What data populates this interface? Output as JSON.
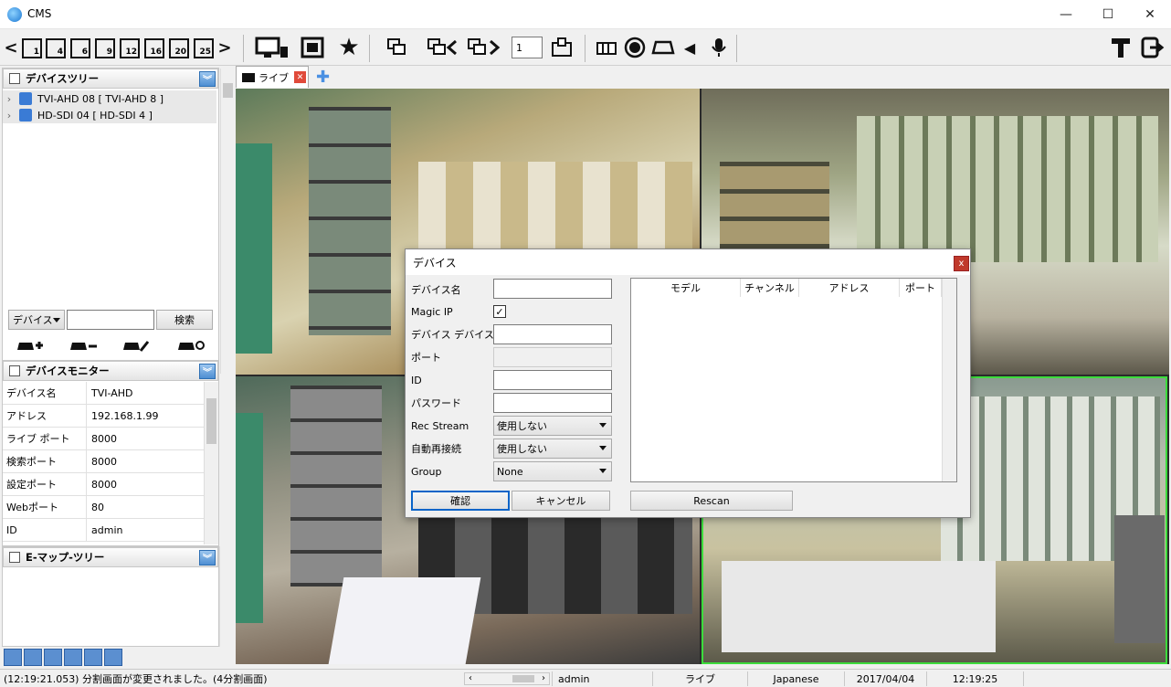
{
  "window": {
    "title": "CMS",
    "minimize": "—",
    "maximize": "☐",
    "close": "✕"
  },
  "toolbar": {
    "grid_options": [
      "1",
      "4",
      "6",
      "9",
      "12",
      "16",
      "20",
      "25"
    ],
    "page_value": "1",
    "nav_prev": "<",
    "nav_next": ">"
  },
  "device_tree": {
    "title": "デバイスツリー",
    "items": [
      {
        "label": "TVI-AHD 08 [ TVI-AHD 8 ]"
      },
      {
        "label": "HD-SDI 04 [ HD-SDI 4 ]"
      }
    ],
    "filter_select": "デバイス",
    "search_button": "検索"
  },
  "device_monitor": {
    "title": "デバイスモニター",
    "rows": [
      {
        "key": "デバイス名",
        "value": "TVI-AHD"
      },
      {
        "key": "アドレス",
        "value": "192.168.1.99"
      },
      {
        "key": "ライブ ポート",
        "value": "8000"
      },
      {
        "key": "検索ポート",
        "value": "8000"
      },
      {
        "key": "設定ポート",
        "value": "8000"
      },
      {
        "key": "Webポート",
        "value": "80"
      },
      {
        "key": "ID",
        "value": "admin"
      }
    ]
  },
  "emap": {
    "title": "E-マップ-ツリー"
  },
  "tabs": {
    "live_label": "ライブ"
  },
  "dialog": {
    "title": "デバイス",
    "close": "x",
    "fields": {
      "device_name": "デバイス名",
      "magic_ip": "Magic IP",
      "device_device_name": "デバイス デバイス名",
      "port": "ポート",
      "id": "ID",
      "password": "パスワード",
      "rec_stream": "Rec Stream",
      "auto_reconnect": "自動再接続",
      "group": "Group"
    },
    "rec_stream_value": "使用しない",
    "auto_reconnect_value": "使用しない",
    "group_value": "None",
    "columns": [
      "モデル",
      "チャンネル",
      "アドレス",
      "ポート"
    ],
    "ok_button": "確認",
    "cancel_button": "キャンセル",
    "rescan_button": "Rescan"
  },
  "status": {
    "message": "(12:19:21.053)  分割画面が変更されました。(4分割画面)",
    "user": "admin",
    "mode": "ライブ",
    "language": "Japanese",
    "date": "2017/04/04",
    "time": "12:19:25"
  }
}
